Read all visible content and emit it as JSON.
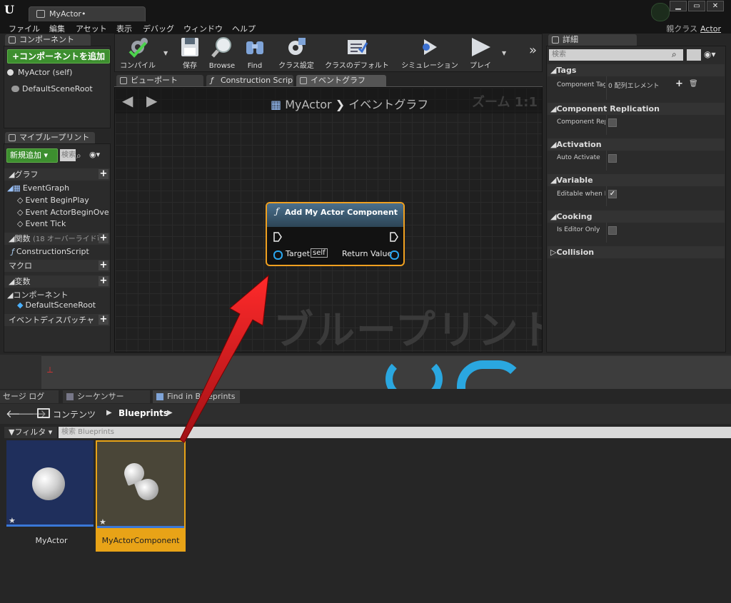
{
  "window": {
    "tab_title": "MyActor•",
    "parent_class_label": "親クラス",
    "parent_class_value": "Actor",
    "controls": [
      "▁",
      "▭",
      "✕"
    ]
  },
  "menu": [
    "ファイル",
    "編集",
    "アセット",
    "表示",
    "デバッグ",
    "ウィンドウ",
    "ヘルプ"
  ],
  "components_panel": {
    "tab": "コンポーネント",
    "add_button": "+コンポーネントを追加",
    "items": [
      "MyActor (self)",
      "DefaultSceneRoot"
    ]
  },
  "my_blueprint": {
    "tab": "マイブループリント",
    "add_new": "新規追加",
    "search_placeholder": "検索",
    "graphs_label": "グラフ",
    "event_graph": "EventGraph",
    "events": [
      "Event BeginPlay",
      "Event ActorBeginOve",
      "Event Tick"
    ],
    "functions_label": "関数",
    "functions_note": "(18 オーバーライド可",
    "construction_script": "ConstructionScript",
    "macros_label": "マクロ",
    "variables_label": "変数",
    "components_label": "コンポーネント",
    "default_scene_root": "DefaultSceneRoot",
    "dispatchers_label": "イベントディスパッチャ"
  },
  "toolbar": {
    "compile": "コンパイル",
    "save": "保存",
    "browse": "Browse",
    "find": "Find",
    "class_settings": "クラス設定",
    "class_defaults": "クラスのデフォルト",
    "simulation": "シミュレーション",
    "play": "プレイ",
    "more": "»"
  },
  "editor_tabs": [
    "ビューポート",
    "Construction Scrip",
    "イベントグラフ"
  ],
  "graph": {
    "breadcrumb_root": "MyActor",
    "breadcrumb_sep": "❯",
    "breadcrumb_current": "イベントグラフ",
    "zoom": "ズーム 1:1",
    "watermark": "ブループリント",
    "node": {
      "title": "Add My Actor Component",
      "target_label": "Target",
      "target_value": "self",
      "return_label": "Return Value"
    }
  },
  "details": {
    "tab": "詳細",
    "search_placeholder": "検索",
    "sections": {
      "tags": "Tags",
      "component_replication": "Component Replication",
      "activation": "Activation",
      "variable": "Variable",
      "cooking": "Cooking",
      "collision": "Collision"
    },
    "props": {
      "component_tags": "Component Tag",
      "component_tags_value": "0 配列エレメント",
      "component_replicates": "Component Repl",
      "auto_activate": "Auto Activate",
      "editable_when_inherited": "Editable when In",
      "is_editor_only": "Is Editor Only"
    },
    "checkbox_states": {
      "component_replicates": false,
      "auto_activate": false,
      "editable_when_inherited": true,
      "is_editor_only": false
    }
  },
  "bottom_tabs": [
    "セージ ログ",
    "シーケンサー",
    "Find in Blueprints"
  ],
  "content_browser": {
    "path_root": "コンテンツ",
    "path_folder": "Blueprints",
    "filter": "フィルタ",
    "search_placeholder": "検索 Blueprints",
    "assets": [
      "MyActor",
      "MyActorComponent"
    ]
  },
  "colors": {
    "node_border": "#f0a020",
    "selection": "#e8a317",
    "add_green": "#3d8f2f",
    "arrow_red": "#e0191e"
  }
}
